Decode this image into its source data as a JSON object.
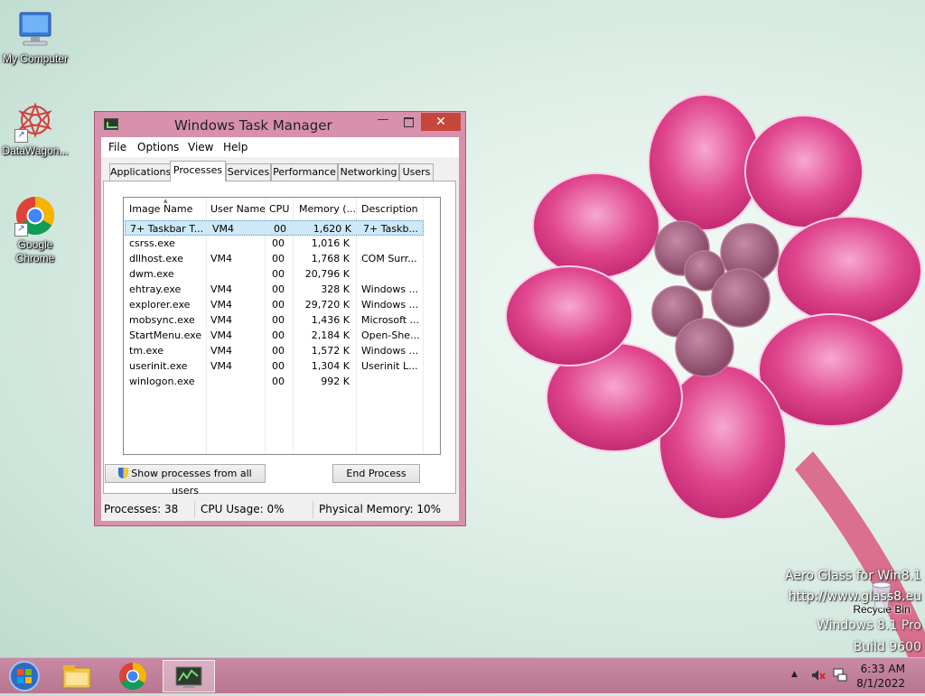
{
  "desktop": {
    "icons": [
      {
        "label": "My Computer",
        "icon": "my-computer-icon"
      },
      {
        "label": "DataWagon...",
        "icon": "datawagon-icon"
      },
      {
        "label": "Google Chrome",
        "icon": "chrome-icon"
      },
      {
        "label": "Recycle Bin",
        "icon": "recycle-bin-icon"
      }
    ],
    "watermark": {
      "line1": "Aero Glass for Win8.1",
      "line2": "http://www.glass8.eu",
      "line3": "Windows 8.1 Pro",
      "line4": "Build 9600"
    }
  },
  "task_manager": {
    "title": "Windows Task Manager",
    "window_buttons": {
      "minimize": "—",
      "close": "✕"
    },
    "menu": [
      "File",
      "Options",
      "View",
      "Help"
    ],
    "tabs": [
      "Applications",
      "Processes",
      "Services",
      "Performance",
      "Networking",
      "Users"
    ],
    "active_tab": "Processes",
    "columns": [
      "Image Name",
      "User Name",
      "CPU",
      "Memory (...",
      "Description"
    ],
    "processes": [
      {
        "name": "7+ Taskbar T...",
        "user": "VM4",
        "cpu": "00",
        "mem": "1,620 K",
        "desc": "7+ Taskb...",
        "selected": true
      },
      {
        "name": "csrss.exe",
        "user": "",
        "cpu": "00",
        "mem": "1,016 K",
        "desc": ""
      },
      {
        "name": "dllhost.exe",
        "user": "VM4",
        "cpu": "00",
        "mem": "1,768 K",
        "desc": "COM Surr..."
      },
      {
        "name": "dwm.exe",
        "user": "",
        "cpu": "00",
        "mem": "20,796 K",
        "desc": ""
      },
      {
        "name": "ehtray.exe",
        "user": "VM4",
        "cpu": "00",
        "mem": "328 K",
        "desc": "Windows ..."
      },
      {
        "name": "explorer.exe",
        "user": "VM4",
        "cpu": "00",
        "mem": "29,720 K",
        "desc": "Windows ..."
      },
      {
        "name": "mobsync.exe",
        "user": "VM4",
        "cpu": "00",
        "mem": "1,436 K",
        "desc": "Microsoft ..."
      },
      {
        "name": "StartMenu.exe",
        "user": "VM4",
        "cpu": "00",
        "mem": "2,184 K",
        "desc": "Open-She..."
      },
      {
        "name": "tm.exe",
        "user": "VM4",
        "cpu": "00",
        "mem": "1,572 K",
        "desc": "Windows ..."
      },
      {
        "name": "userinit.exe",
        "user": "VM4",
        "cpu": "00",
        "mem": "1,304 K",
        "desc": "Userinit L..."
      },
      {
        "name": "winlogon.exe",
        "user": "",
        "cpu": "00",
        "mem": "992 K",
        "desc": ""
      }
    ],
    "show_all_button": "Show processes from all users",
    "end_process_button": "End Process",
    "status": {
      "processes": "Processes: 38",
      "cpu": "CPU Usage: 0%",
      "memory": "Physical Memory: 10%"
    }
  },
  "taskbar": {
    "items": [
      "start-orb-icon",
      "file-explorer-icon",
      "chrome-icon",
      "task-manager-icon"
    ],
    "clock": {
      "time": "6:33 AM",
      "date": "8/1/2022"
    },
    "tray": [
      "show-hidden-icons-icon",
      "volume-muted-icon",
      "network-icon"
    ]
  },
  "colors": {
    "window_frame": "#d891ac",
    "close_button": "#c7463c",
    "taskbar": "#c080a0",
    "selection": "#cde8f7"
  }
}
